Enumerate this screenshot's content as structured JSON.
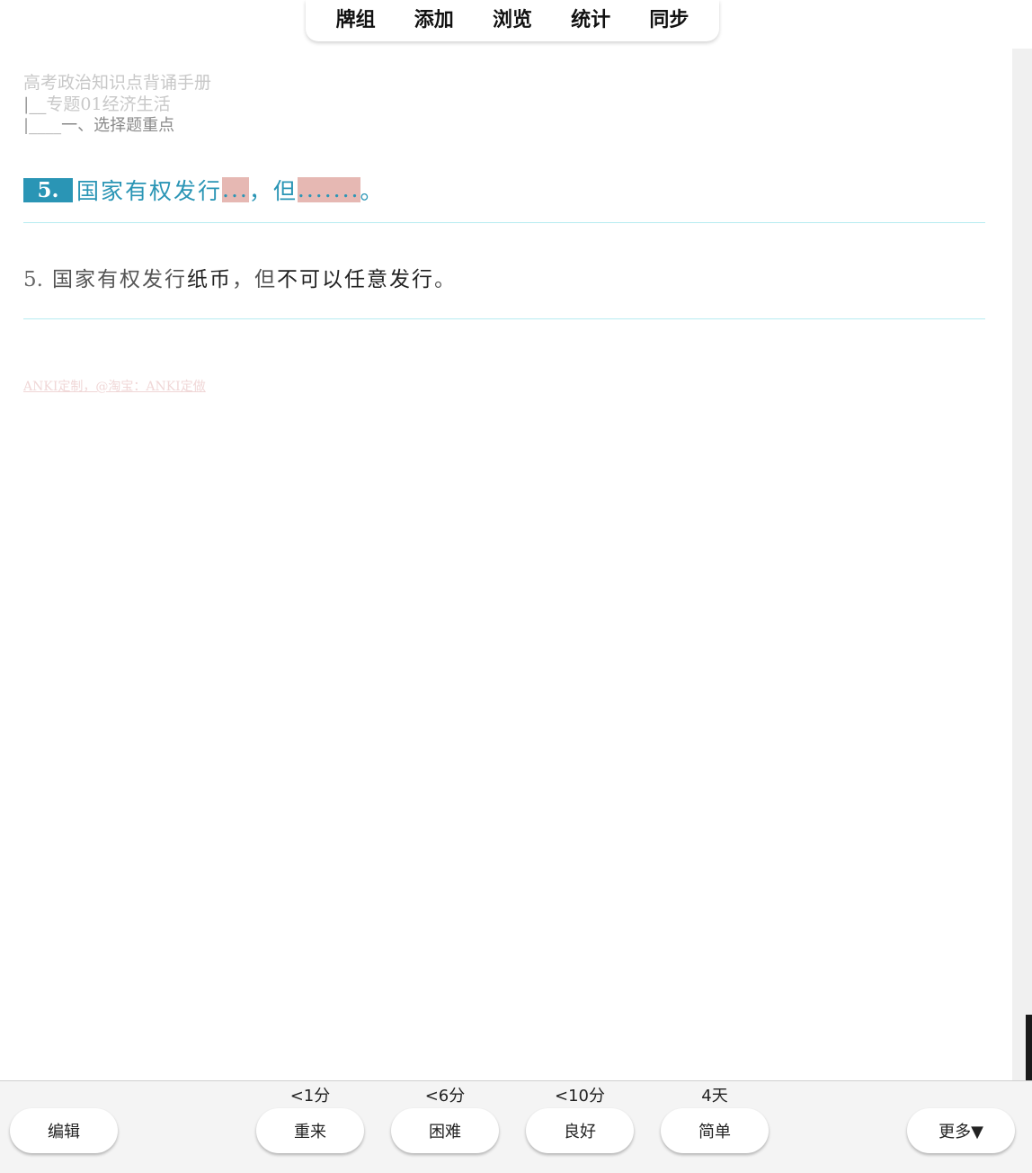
{
  "topnav": {
    "items": [
      "牌组",
      "添加",
      "浏览",
      "统计",
      "同步"
    ]
  },
  "card": {
    "breadcrumb": {
      "level1": "高考政治知识点背诵手册",
      "level2_prefix": "|__",
      "level2": "专题01经济生活",
      "level3_prefix": "|____",
      "level3": "一、选择题重点"
    },
    "question": {
      "number": "5.",
      "text_before": "国家有权发行",
      "cloze1": "...",
      "text_middle": "，但",
      "cloze2": ".......",
      "text_end": "。"
    },
    "answer": {
      "number": "5.",
      "text_before": "国家有权发行",
      "fill1": "纸币",
      "text_middle": "，但",
      "fill2": "不可以任意发行",
      "text_end": "。"
    },
    "footer": "ANKI定制，@淘宝：ANKI定做"
  },
  "bottombar": {
    "edit_label": "编辑",
    "more_label": "更多▼",
    "answers": [
      {
        "interval": "<1分",
        "label": "重来"
      },
      {
        "interval": "<6分",
        "label": "困难"
      },
      {
        "interval": "<10分",
        "label": "良好"
      },
      {
        "interval": "4天",
        "label": "简单"
      }
    ]
  },
  "colors": {
    "accent": "#2a95b5",
    "cloze_bg": "#e6b8b3",
    "divider": "#b7ecf1"
  }
}
